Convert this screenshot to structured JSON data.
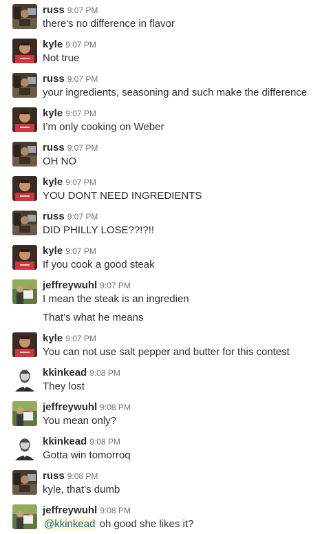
{
  "messages": [
    {
      "user": "russ",
      "time": "9:07 PM",
      "avatar": "avatar-russ",
      "text": "there's no difference in flavor"
    },
    {
      "user": "kyle",
      "time": "9:07 PM",
      "avatar": "avatar-kyle",
      "text": "Not true"
    },
    {
      "user": "russ",
      "time": "9:07 PM",
      "avatar": "avatar-russ",
      "text": "your ingredients, seasoning and such make the difference"
    },
    {
      "user": "kyle",
      "time": "9:07 PM",
      "avatar": "avatar-kyle",
      "text": "I’m only cooking on Weber"
    },
    {
      "user": "russ",
      "time": "9:07 PM",
      "avatar": "avatar-russ",
      "text": "OH NO"
    },
    {
      "user": "kyle",
      "time": "9:07 PM",
      "avatar": "avatar-kyle",
      "text": "YOU DONT NEED INGREDIENTS"
    },
    {
      "user": "russ",
      "time": "9:07 PM",
      "avatar": "avatar-russ",
      "text": "DID PHILLY LOSE??!?!!"
    },
    {
      "user": "kyle",
      "time": "9:07 PM",
      "avatar": "avatar-kyle",
      "text": "If you cook a good steak"
    },
    {
      "user": "jeffreywuhl",
      "time": "9:07 PM",
      "avatar": "avatar-jeffreywuhl",
      "text": "I mean the steak is an ingredien"
    },
    {
      "continuation": true,
      "text": "That’s what he means"
    },
    {
      "user": "kyle",
      "time": "9:07 PM",
      "avatar": "avatar-kyle",
      "text": "You can not use salt pepper and butter for this contest"
    },
    {
      "user": "kkinkead",
      "time": "9:08 PM",
      "avatar": "avatar-kkinkead",
      "text": "They lost"
    },
    {
      "user": "jeffreywuhl",
      "time": "9:08 PM",
      "avatar": "avatar-jeffreywuhl",
      "text": "You mean only?"
    },
    {
      "user": "kkinkead",
      "time": "9:08 PM",
      "avatar": "avatar-kkinkead",
      "text": "Gotta win tomorroq"
    },
    {
      "user": "russ",
      "time": "9:08 PM",
      "avatar": "avatar-russ",
      "text": "kyle, that’s dumb"
    },
    {
      "user": "jeffreywuhl",
      "time": "9:08 PM",
      "avatar": "avatar-jeffreywuhl",
      "mention": "@kkinkead",
      "text": "oh good she likes it?"
    }
  ],
  "colors": {
    "mention_bg": "#fdf5d0",
    "mention_fg": "#1264a3",
    "timestamp": "#717274"
  }
}
